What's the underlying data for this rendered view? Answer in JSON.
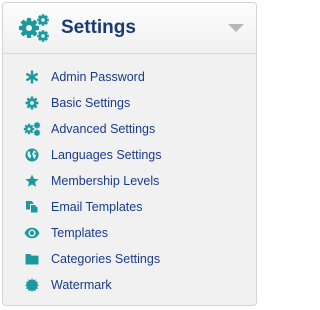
{
  "header": {
    "title": "Settings",
    "icon": "gears-icon",
    "collapse_icon": "chevron-down-icon"
  },
  "menu": {
    "items": [
      {
        "label": "Admin Password",
        "icon": "asterisk-icon"
      },
      {
        "label": "Basic Settings",
        "icon": "gear-icon"
      },
      {
        "label": "Advanced Settings",
        "icon": "gears-icon"
      },
      {
        "label": "Languages Settings",
        "icon": "globe-icon"
      },
      {
        "label": "Membership Levels",
        "icon": "star-icon"
      },
      {
        "label": "Email Templates",
        "icon": "copy-icon"
      },
      {
        "label": "Templates",
        "icon": "eye-icon"
      },
      {
        "label": "Categories Settings",
        "icon": "folder-icon"
      },
      {
        "label": "Watermark",
        "icon": "certificate-icon"
      }
    ]
  },
  "colors": {
    "accent": "#1a9a9e",
    "title": "#1b3a74",
    "link": "#1a3b8c",
    "background": "#f1f1f1"
  }
}
